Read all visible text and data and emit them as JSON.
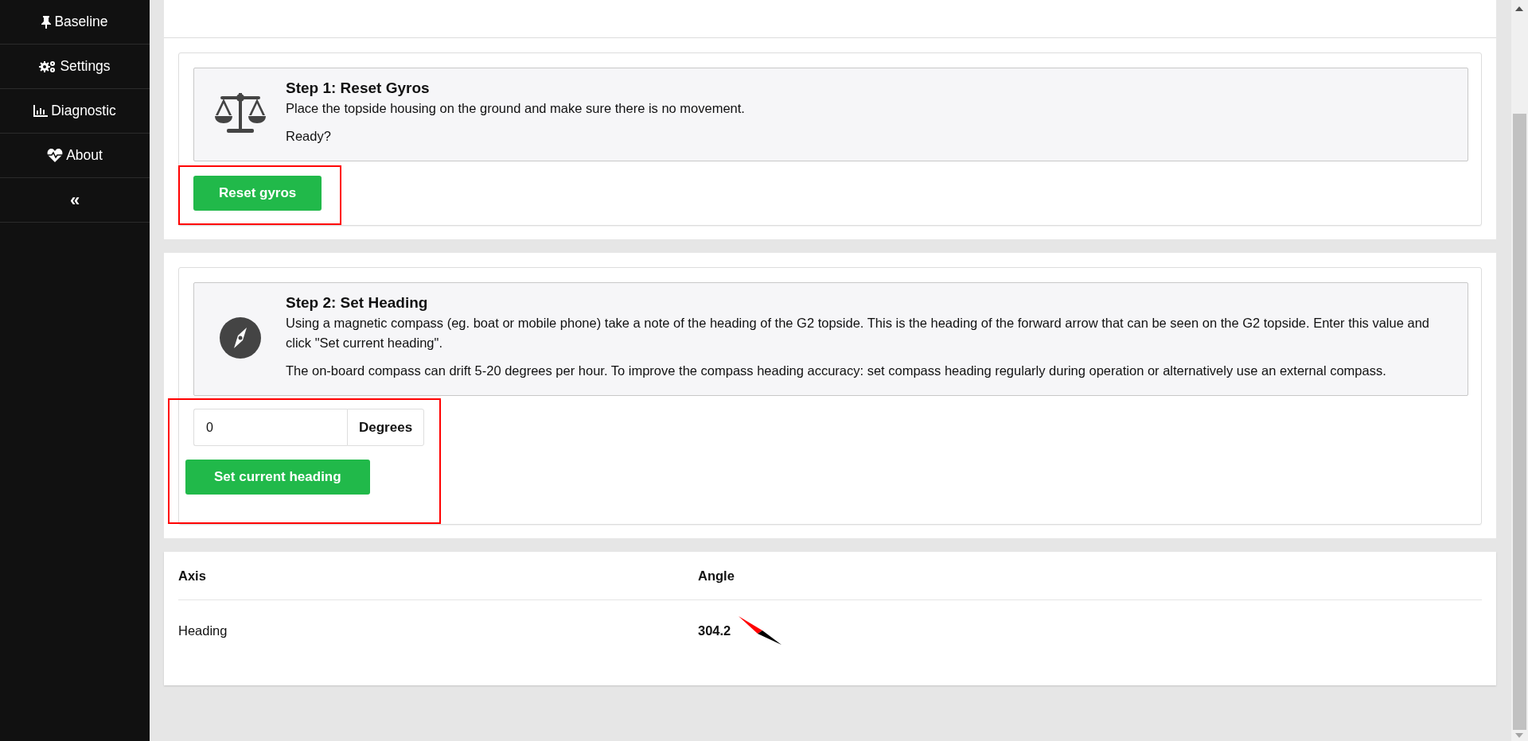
{
  "sidebar": {
    "items": [
      {
        "label": "Baseline"
      },
      {
        "label": "Settings"
      },
      {
        "label": "Diagnostic"
      },
      {
        "label": "About"
      },
      {
        "label": "«"
      }
    ]
  },
  "steps": [
    {
      "kind": "confirm",
      "title": "Step 1: Reset Gyros",
      "paragraphs": [
        "Place the topside housing on the ground and make sure there is no movement.",
        "Ready?"
      ],
      "button": "Reset gyros",
      "highlighted": true
    },
    {
      "kind": "input",
      "title": "Step 2: Set Heading",
      "paragraphs": [
        "Using a magnetic compass (eg. boat or mobile phone) take a note of the heading of the G2 topside. This is the heading of the forward arrow that can be seen on the G2 topside. Enter this value and click \"Set current heading\".",
        "The on-board compass can drift 5-20 degrees per hour. To improve the compass heading accuracy: set compass heading regularly during operation or alternatively use an external compass."
      ],
      "input": {
        "value": "0",
        "addon": "Degrees"
      },
      "button": "Set current heading",
      "highlighted": true
    }
  ],
  "table": {
    "columns": [
      "Axis",
      "Angle"
    ],
    "rows": [
      {
        "cells": [
          "Heading",
          "304.2"
        ]
      }
    ]
  }
}
